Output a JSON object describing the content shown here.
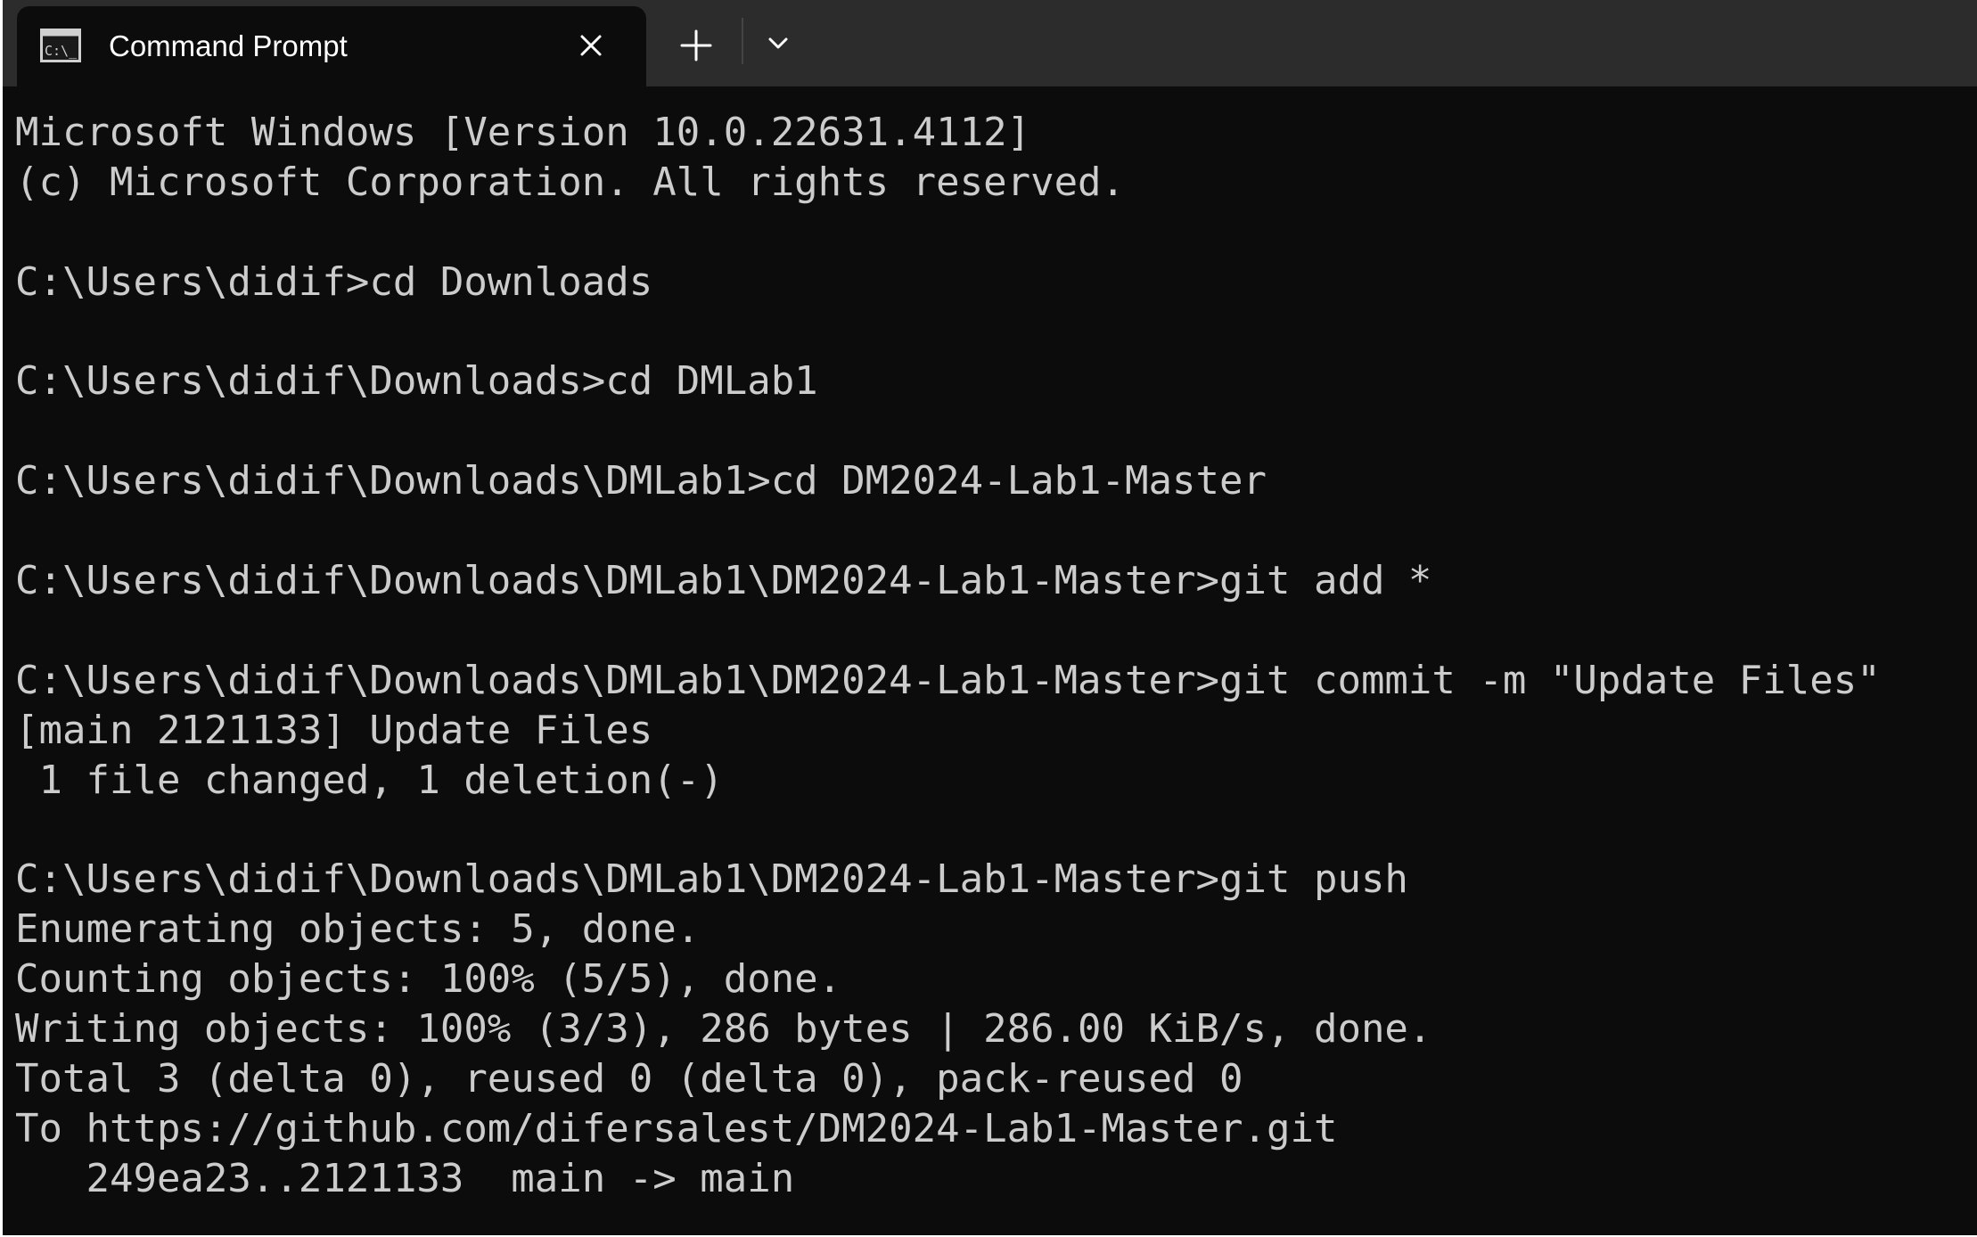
{
  "window": {
    "tab_title": "Command Prompt",
    "tab_icon": "cmd-icon",
    "close_icon": "close-icon",
    "new_tab_icon": "plus-icon",
    "dropdown_icon": "chevron-down-icon"
  },
  "colors": {
    "titlebar": "#2c2c2c",
    "terminal_bg": "#0c0c0c",
    "text": "#cccccc",
    "tab_text": "#ffffff"
  },
  "terminal": {
    "lines": [
      "Microsoft Windows [Version 10.0.22631.4112]",
      "(c) Microsoft Corporation. All rights reserved.",
      "",
      "C:\\Users\\didif>cd Downloads",
      "",
      "C:\\Users\\didif\\Downloads>cd DMLab1",
      "",
      "C:\\Users\\didif\\Downloads\\DMLab1>cd DM2024-Lab1-Master",
      "",
      "C:\\Users\\didif\\Downloads\\DMLab1\\DM2024-Lab1-Master>git add *",
      "",
      "C:\\Users\\didif\\Downloads\\DMLab1\\DM2024-Lab1-Master>git commit -m \"Update Files\"",
      "[main 2121133] Update Files",
      " 1 file changed, 1 deletion(-)",
      "",
      "C:\\Users\\didif\\Downloads\\DMLab1\\DM2024-Lab1-Master>git push",
      "Enumerating objects: 5, done.",
      "Counting objects: 100% (5/5), done.",
      "Writing objects: 100% (3/3), 286 bytes | 286.00 KiB/s, done.",
      "Total 3 (delta 0), reused 0 (delta 0), pack-reused 0",
      "To https://github.com/difersalest/DM2024-Lab1-Master.git",
      "   249ea23..2121133  main -> main"
    ]
  }
}
